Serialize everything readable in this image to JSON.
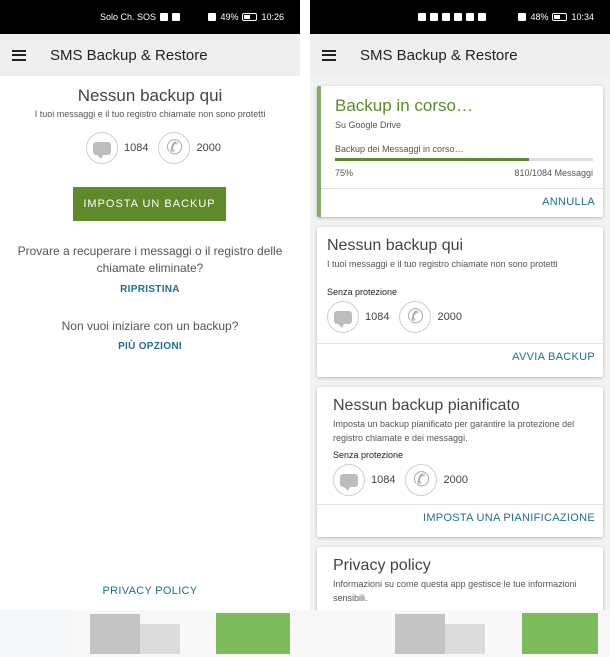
{
  "left": {
    "status": {
      "carrier": "Solo Ch. SOS",
      "battery": "49%",
      "time": "10:26"
    },
    "app_title": "SMS Backup & Restore",
    "empty_title": "Nessun backup qui",
    "empty_subtitle": "I tuoi messaggi e il tuo registro chiamate non sono protetti",
    "message_count": "1084",
    "call_count": "2000",
    "setup_button": "IMPOSTA UN BACKUP",
    "recover_question": "Provare a recuperare i messaggi o il registro delle chiamate eliminate?",
    "restore_link": "RIPRISTINA",
    "no_backup_question": "Non vuoi iniziare con un backup?",
    "more_options_link": "PIÙ OPZIONI",
    "privacy_link": "PRIVACY POLICY"
  },
  "right": {
    "status": {
      "battery": "48%",
      "time": "10:34"
    },
    "app_title": "SMS Backup & Restore",
    "progress_card": {
      "title": "Backup in corso…",
      "subtitle": "Su Google Drive",
      "detail": "Backup dei Messaggi in corso…",
      "percent": "75%",
      "progress_value": 0.75,
      "counter": "810/1084 Messaggi",
      "cancel": "ANNULLA"
    },
    "backup_card": {
      "title": "Nessun backup qui",
      "subtitle": "I tuoi messaggi e il tuo registro chiamate non sono protetti",
      "protection": "Senza protezione",
      "message_count": "1084",
      "call_count": "2000",
      "action": "AVVIA BACKUP"
    },
    "schedule_card": {
      "title": "Nessun backup pianificato",
      "subtitle": "Imposta un backup pianificato per garantire la protezione del registro chiamate e dei messaggi.",
      "protection": "Senza protezione",
      "message_count": "1084",
      "call_count": "2000",
      "action": "IMPOSTA UNA PIANIFICAZIONE"
    },
    "privacy_card": {
      "title": "Privacy policy",
      "subtitle": "Informazioni su come questa app gestisce le tue informazioni sensibili."
    }
  },
  "colors": {
    "accent_green": "#5e8a2c",
    "link_blue": "#1e6f8f"
  },
  "icons": [
    "menu-icon",
    "message-icon",
    "phone-icon",
    "wifi-icon",
    "battery-icon"
  ]
}
